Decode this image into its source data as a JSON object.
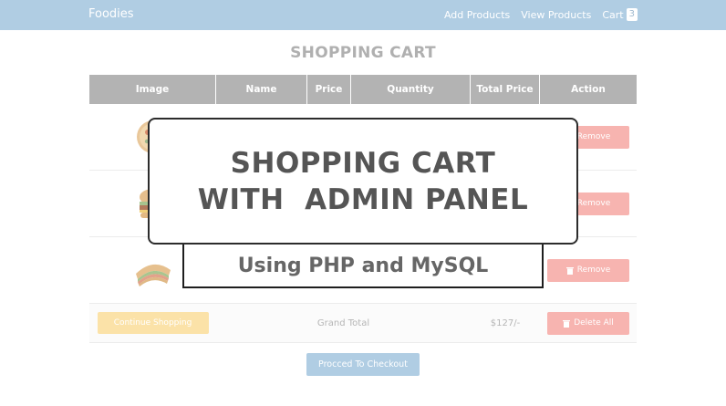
{
  "navbar": {
    "brand": "Foodies",
    "links": [
      "Add Products",
      "View Products"
    ],
    "cart_label": "Cart",
    "cart_count": "3"
  },
  "page": {
    "heading": "SHOPPING CART"
  },
  "table": {
    "headers": [
      "Image",
      "Name",
      "Price",
      "Quantity",
      "Total Price",
      "Action"
    ],
    "rows": [
      {
        "image_icon": "pizza-icon",
        "remove_label": "Remove"
      },
      {
        "image_icon": "burger-icon",
        "remove_label": "Remove"
      },
      {
        "image_icon": "sandwich-icon",
        "remove_label": "Remove"
      }
    ],
    "footer": {
      "continue_label": "Continue Shopping",
      "grand_total_label": "Grand Total",
      "grand_total_value": "$127/-",
      "delete_all_label": "Delete All"
    }
  },
  "checkout_label": "Procced To Checkout",
  "overlay": {
    "title_line1": "SHOPPING CART",
    "title_line2": "WITH  ADMIN PANEL",
    "subtitle": "Using PHP and MySQL"
  },
  "colors": {
    "navbar": "#b0cde3",
    "table_header": "#b3b3b3",
    "remove_button": "#f7b4b0",
    "continue_button": "#fbe2a8",
    "checkout_button": "#b0cde3"
  }
}
